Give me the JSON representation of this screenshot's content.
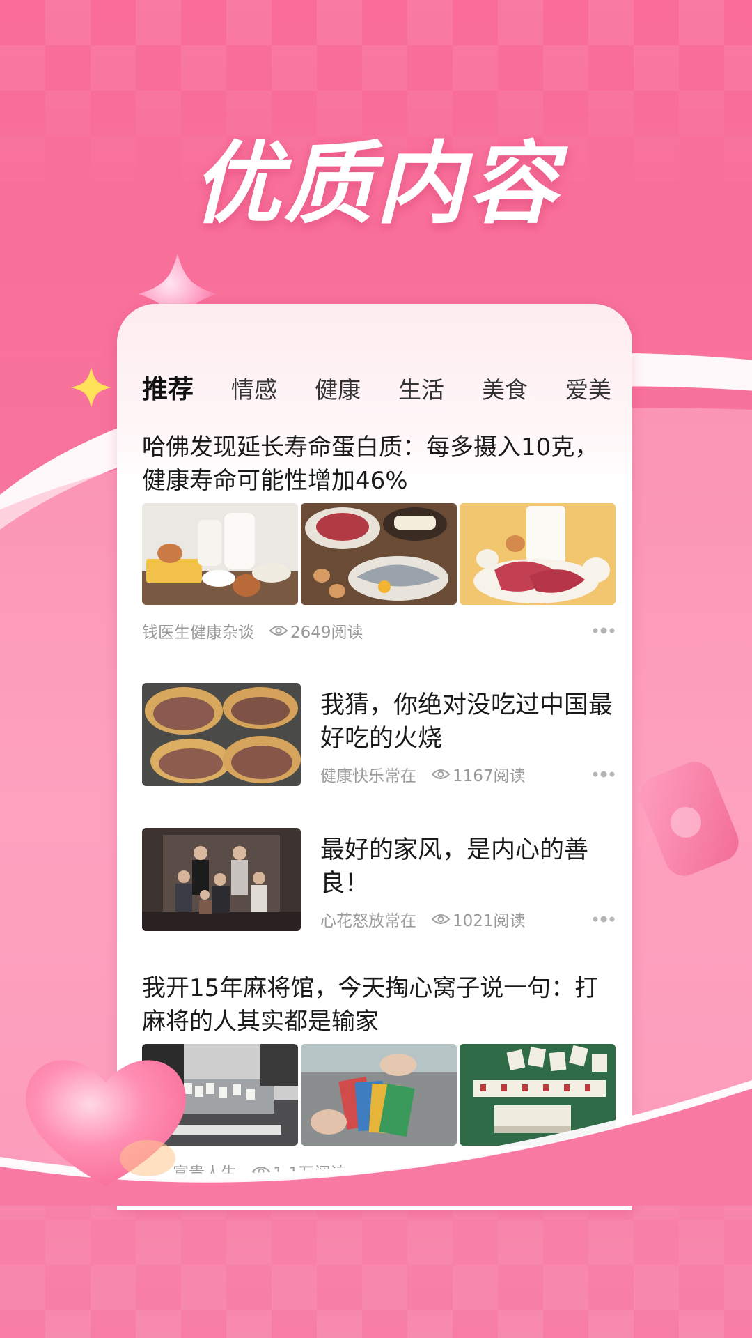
{
  "headline": "优质内容",
  "tabs": [
    {
      "label": "推荐",
      "active": true
    },
    {
      "label": "情感"
    },
    {
      "label": "健康"
    },
    {
      "label": "生活"
    },
    {
      "label": "美食"
    },
    {
      "label": "爱美"
    }
  ],
  "articles": [
    {
      "title": "哈佛发现延长寿命蛋白质：每多摄入10克，健康寿命可能性增加46%",
      "source": "钱医生健康杂谈",
      "reads": "2649阅读",
      "thumbs": [
        "dairy-eggs-photo",
        "meat-fish-eggs-photo",
        "milk-steak-eggs-photo"
      ]
    },
    {
      "title": "我猜，你绝对没吃过中国最好吃的火烧",
      "source": "健康快乐常在",
      "reads": "1167阅读",
      "thumbs": [
        "huoshao-photo"
      ]
    },
    {
      "title": "最好的家风，是内心的善良！",
      "source": "心花怒放常在",
      "reads": "1021阅读",
      "thumbs": [
        "family-portrait-photo"
      ]
    },
    {
      "title": "我开15年麻将馆，今天掏心窝子说一句：打麻将的人其实都是输家",
      "source": "富贵人生",
      "reads": "1.1万阅读",
      "thumbs": [
        "mahjong-table-photo",
        "mahjong-hands-photo",
        "mahjong-tiles-photo"
      ]
    }
  ],
  "colors": {
    "background": "#f86d98",
    "card": "#ffffff",
    "meta_text": "#9a9a9a",
    "title_text": "#1a1a1a"
  }
}
